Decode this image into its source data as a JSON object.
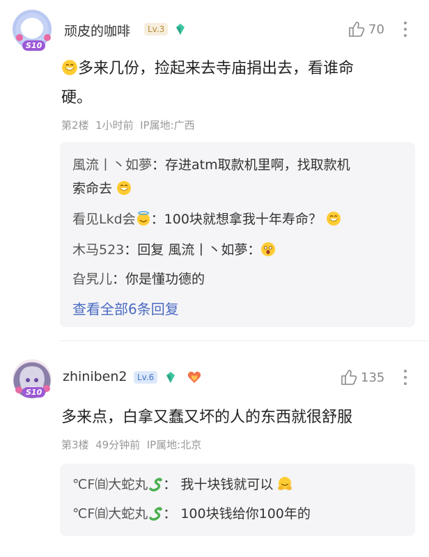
{
  "comments": [
    {
      "username": "顽皮的咖啡",
      "level": "Lv.3",
      "avatar_badge": "S10",
      "likes": "70",
      "text_line1": "多来几份，捡起来去寺庙捐出去，看谁命",
      "text_line2": "硬。",
      "meta": "第2楼  1小时前  IP属地:广西",
      "replies": [
        {
          "who": "風流丨丶如夢",
          "sep": "：",
          "text_line1": "存进atm取款机里啊，找取款机",
          "text_line2": "索命去"
        },
        {
          "who": "看见Lkd会",
          "sep": "：",
          "text": "100块就想拿我十年寿命？"
        },
        {
          "who": "木马523",
          "sep": "：",
          "reply_word": "回复",
          "reply_to": "風流丨丶如夢",
          "sep2": "："
        },
        {
          "who": "旮旯儿",
          "sep": "：",
          "text": "你是懂功德的"
        }
      ],
      "view_all": "查看全部6条回复"
    },
    {
      "username": "zhiniben2",
      "level": "Lv.6",
      "avatar_badge": "S10",
      "likes": "135",
      "text_line1": "多来点，白拿又蠢又坏的人的东西就很舒服",
      "meta": "第3楼  49分钟前  IP属地:北京",
      "replies": [
        {
          "who": "℃F㉂大蛇丸",
          "sep": "：",
          "text": "我十块钱就可以"
        },
        {
          "who": "℃F㉂大蛇丸",
          "sep": "：",
          "text": "100块钱给你100年的"
        }
      ]
    }
  ],
  "colors": {
    "link": "#4a6bc2",
    "lv3": "#c8a46a",
    "lv6": "#5b8fd6",
    "gem": "#3fc4a0"
  }
}
